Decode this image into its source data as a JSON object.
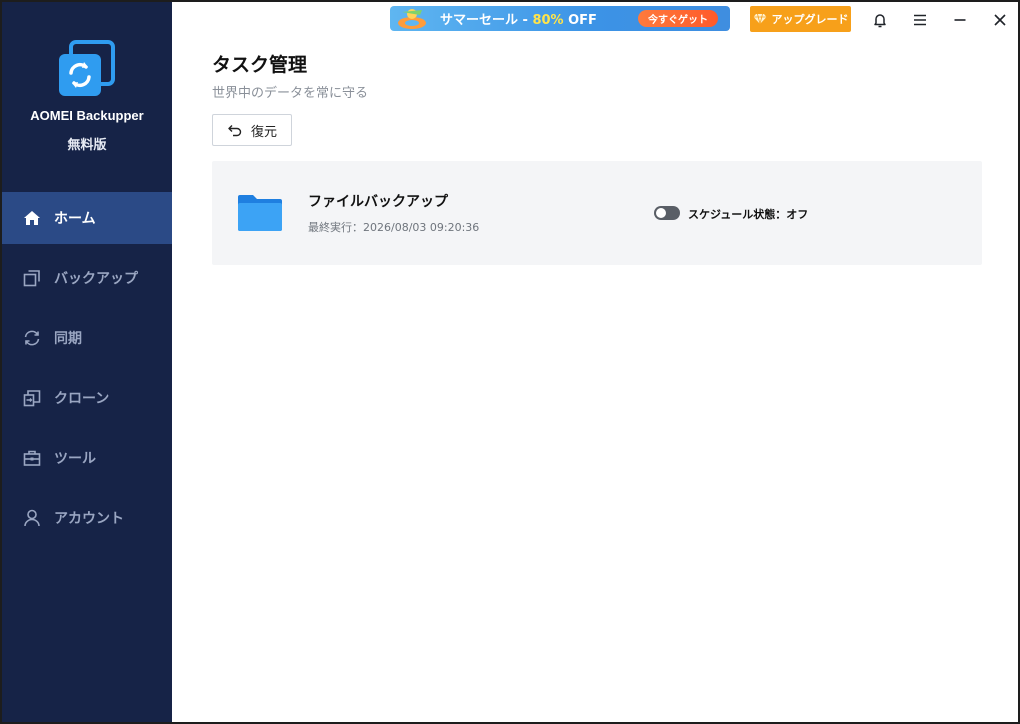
{
  "app": {
    "name": "AOMEI Backupper",
    "edition": "無料版"
  },
  "sidebar": {
    "items": [
      {
        "label": "ホーム",
        "icon": "home-icon",
        "active": true
      },
      {
        "label": "バックアップ",
        "icon": "backup-icon",
        "active": false
      },
      {
        "label": "同期",
        "icon": "sync-icon",
        "active": false
      },
      {
        "label": "クローン",
        "icon": "clone-icon",
        "active": false
      },
      {
        "label": "ツール",
        "icon": "toolbox-icon",
        "active": false
      },
      {
        "label": "アカウント",
        "icon": "user-icon",
        "active": false
      }
    ]
  },
  "titlebar": {
    "promo": {
      "text_before": "サマーセール - ",
      "percent": "80%",
      "text_after": " OFF",
      "cta": "今すぐゲット"
    },
    "upgrade_label": "アップグレード"
  },
  "main": {
    "title": "タスク管理",
    "subtitle": "世界中のデータを常に守る",
    "restore_label": "復元",
    "tasks": [
      {
        "name": "ファイルバックアップ",
        "last_run": "最終実行：2026/08/03 09:20:36",
        "schedule_status": "スケジュール状態：オフ",
        "schedule_on": false
      }
    ]
  },
  "colors": {
    "sidebar_bg": "#162347",
    "sidebar_active": "#2b4a86",
    "upgrade": "#f7a01a",
    "accent_blue": "#2c8ae8"
  }
}
